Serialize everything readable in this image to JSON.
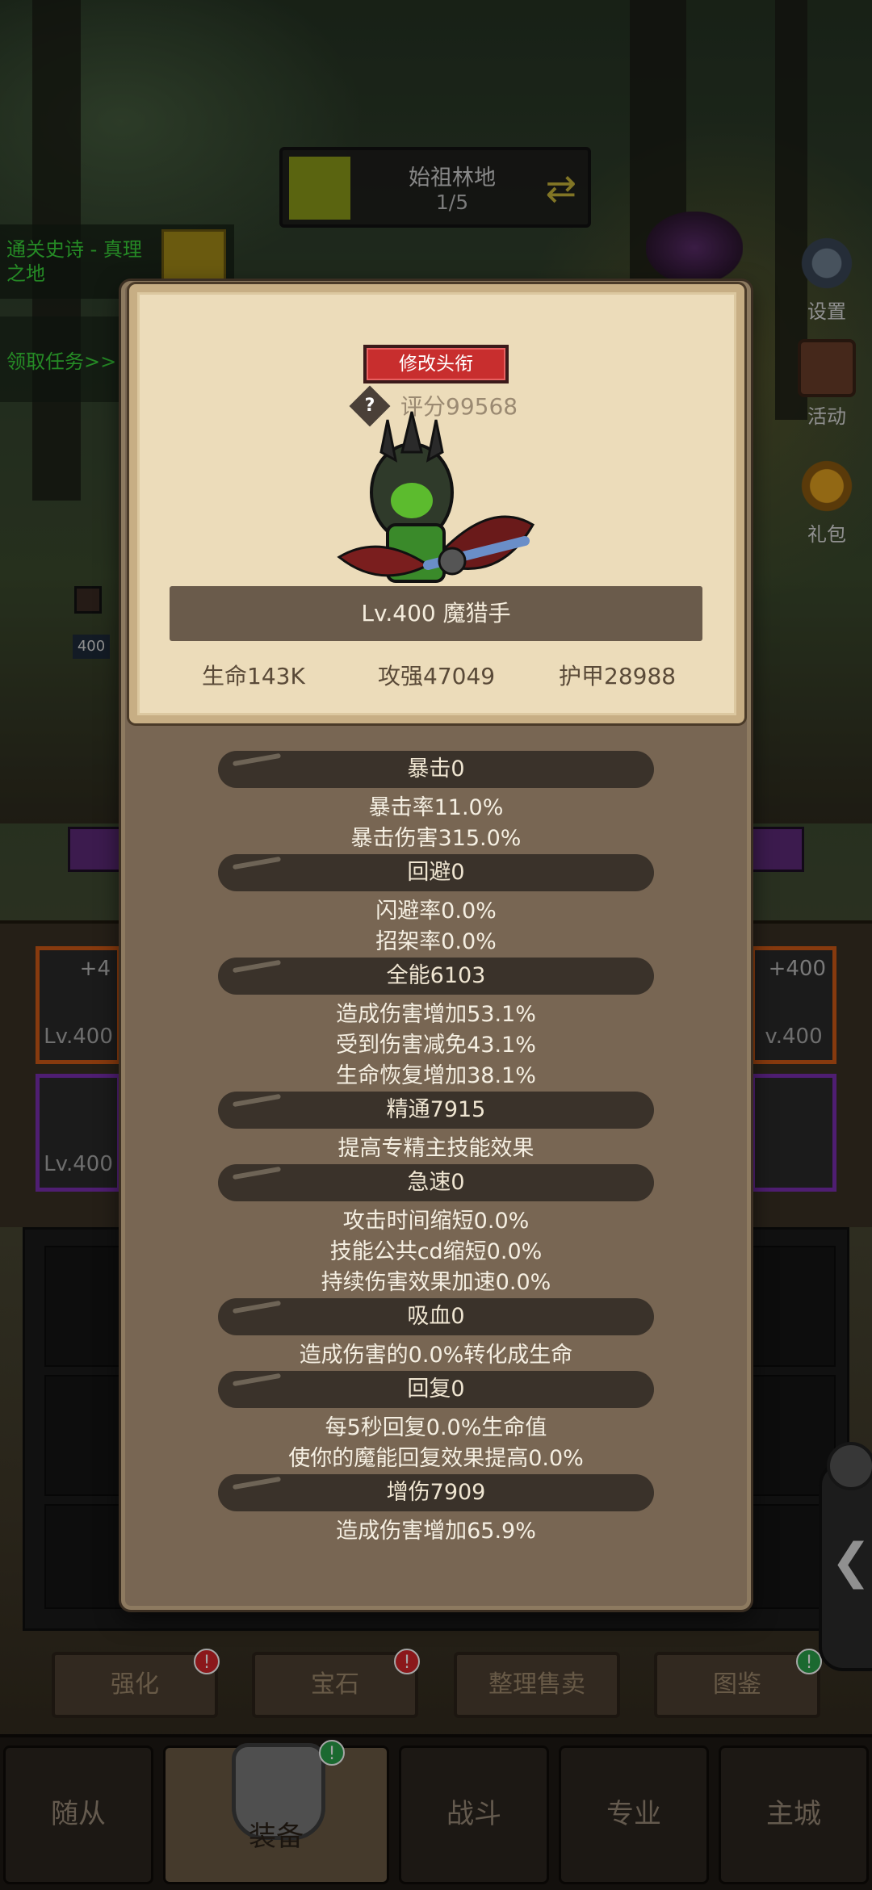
{
  "stage": {
    "name": "始祖林地",
    "progress": "1/5"
  },
  "quests": {
    "main": "通关史诗 - 真理之地",
    "claim": "领取任务>>"
  },
  "side_menu": [
    {
      "label": "设置",
      "icon": "gear-icon"
    },
    {
      "label": "活动",
      "icon": "scroll-icon"
    },
    {
      "label": "礼包",
      "icon": "treasure-chest-icon"
    }
  ],
  "mini_level": "400",
  "equipment_slots": {
    "left_top": {
      "level": "Lv.400",
      "plus": "+4"
    },
    "left_bottom": {
      "level": "Lv.400"
    },
    "right_top": {
      "level": "v.400",
      "plus": "+400"
    }
  },
  "action_buttons": [
    {
      "label": "强化",
      "badge": "!"
    },
    {
      "label": "宝石",
      "badge": "!"
    },
    {
      "label": "整理售卖",
      "badge": ""
    },
    {
      "label": "图鉴",
      "badge": "!"
    }
  ],
  "nav_tabs": [
    {
      "label": "随从"
    },
    {
      "label": "装备",
      "badge": "!"
    },
    {
      "label": "战斗"
    },
    {
      "label": "专业"
    },
    {
      "label": "主城"
    }
  ],
  "side_tab_arrow": "❮",
  "popup": {
    "title_button": "修改头衔",
    "score_icon": "?",
    "score": "评分99568",
    "name": "Lv.400 魔猎手",
    "main_stats": {
      "hp": "生命143K",
      "attack": "攻强47049",
      "armor": "护甲28988"
    },
    "sections": [
      {
        "header": "暴击0",
        "lines": [
          "暴击率11.0%",
          "暴击伤害315.0%"
        ]
      },
      {
        "header": "回避0",
        "lines": [
          "闪避率0.0%",
          "招架率0.0%"
        ]
      },
      {
        "header": "全能6103",
        "lines": [
          "造成伤害增加53.1%",
          "受到伤害减免43.1%",
          "生命恢复增加38.1%"
        ]
      },
      {
        "header": "精通7915",
        "lines": [
          "提高专精主技能效果"
        ]
      },
      {
        "header": "急速0",
        "lines": [
          "攻击时间缩短0.0%",
          "技能公共cd缩短0.0%",
          "持续伤害效果加速0.0%"
        ]
      },
      {
        "header": "吸血0",
        "lines": [
          "造成伤害的0.0%转化成生命"
        ]
      },
      {
        "header": "回复0",
        "lines": [
          "每5秒回复0.0%生命值",
          "使你的魔能回复效果提高0.0%"
        ]
      },
      {
        "header": "增伤7909",
        "lines": [
          "造成伤害增加65.9%"
        ]
      }
    ]
  },
  "colors": {
    "panel": "#786653",
    "card": "#ecdcba",
    "pill": "#3a322a",
    "title_button": "#c82e2e",
    "quest_text": "#3ad43a"
  }
}
